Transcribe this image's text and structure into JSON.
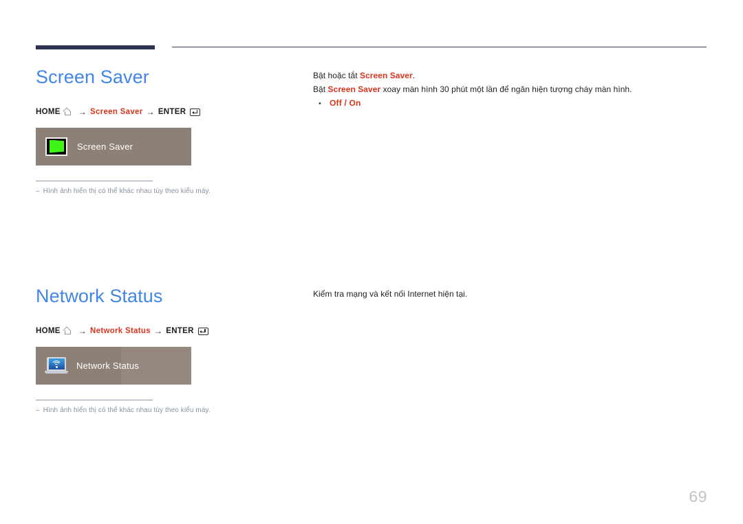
{
  "header": {
    "rule_color": "#2e3350"
  },
  "sections": [
    {
      "title": "Screen Saver",
      "path": {
        "home_label": "HOME",
        "home_icon": "home-icon",
        "arrow": "→",
        "target_label": "Screen Saver",
        "enter_label": "ENTER",
        "enter_icon": "enter-key-icon"
      },
      "preview": {
        "icon": "screen-saver-icon",
        "label": "Screen Saver"
      },
      "footnote": {
        "dash": "–",
        "text": "Hình ảnh hiển thị có thể khác nhau tùy theo kiểu máy."
      }
    },
    {
      "title": "Network Status",
      "path": {
        "home_label": "HOME",
        "home_icon": "home-icon",
        "arrow": "→",
        "target_label": "Network Status",
        "enter_label": "ENTER",
        "enter_icon": "enter-key-icon"
      },
      "preview": {
        "icon": "network-status-icon",
        "label": "Network Status"
      },
      "footnote": {
        "dash": "–",
        "text": "Hình ảnh hiển thị có thể khác nhau tùy theo kiểu máy."
      }
    }
  ],
  "body": {
    "screen_saver": {
      "line1_pre": "Bật hoặc tắt ",
      "line1_hl": "Screen Saver",
      "line1_post": ".",
      "line2_pre": "Bật ",
      "line2_hl": "Screen Saver",
      "line2_post": " xoay màn hình 30 phút một lần để ngăn hiện tượng cháy màn hình.",
      "bullet_dot": "•",
      "bullet_text": "Off / On"
    },
    "network_status": {
      "line1": "Kiểm tra mạng và kết nối Internet hiện tại."
    }
  },
  "footer": {
    "page_number": "69"
  },
  "colors": {
    "heading": "#4285e8",
    "highlight": "#d8341c",
    "preview_box": "#8d8077",
    "preview_box_alt": "#96877f",
    "footnote": "#8790a0",
    "page_number": "#c4c4c4"
  }
}
